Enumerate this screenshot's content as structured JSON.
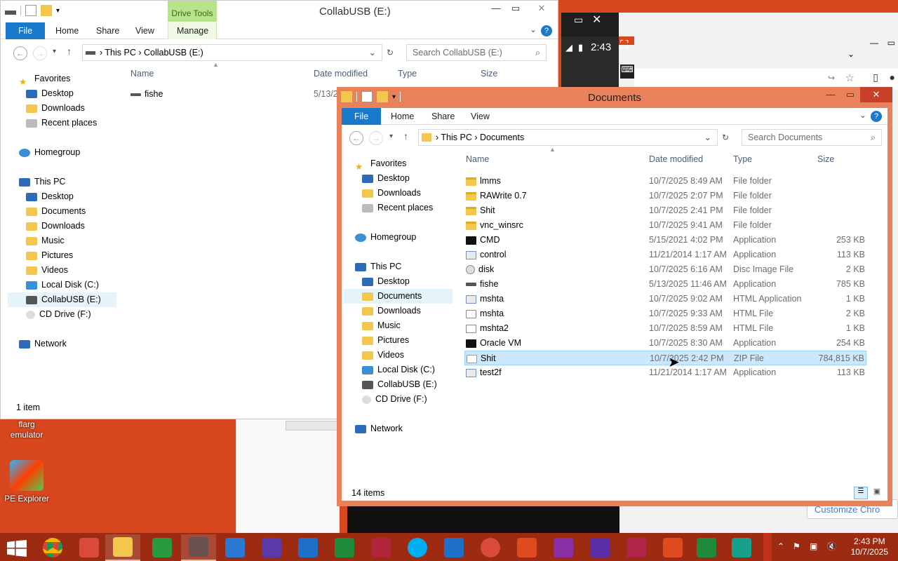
{
  "desktop": {
    "icons": [
      {
        "label": "flarg\nemulator"
      },
      {
        "label": "PE Explorer"
      }
    ]
  },
  "bg_window": {
    "time": "2:43",
    "customize_btn": "Customize Chro"
  },
  "win1": {
    "title": "CollabUSB (E:)",
    "drive_tools": "Drive Tools",
    "tabs": [
      "File",
      "Home",
      "Share",
      "View",
      "Manage"
    ],
    "address": [
      "This PC",
      "CollabUSB (E:)"
    ],
    "search_placeholder": "Search CollabUSB (E:)",
    "columns": [
      "Name",
      "Date modified",
      "Type",
      "Size"
    ],
    "rows": [
      {
        "name": "fishe",
        "date": "5/13/2"
      }
    ],
    "nav": {
      "favorites": "Favorites",
      "fav_items": [
        "Desktop",
        "Downloads",
        "Recent places"
      ],
      "homegroup": "Homegroup",
      "thispc": "This PC",
      "pc_items": [
        "Desktop",
        "Documents",
        "Downloads",
        "Music",
        "Pictures",
        "Videos",
        "Local Disk (C:)",
        "CollabUSB (E:)",
        "CD Drive (F:)"
      ],
      "network": "Network"
    },
    "status": "1 item"
  },
  "win2": {
    "title": "Documents",
    "tabs": [
      "File",
      "Home",
      "Share",
      "View"
    ],
    "address": [
      "This PC",
      "Documents"
    ],
    "search_placeholder": "Search Documents",
    "columns": [
      "Name",
      "Date modified",
      "Type",
      "Size"
    ],
    "rows": [
      {
        "name": "lmms",
        "date": "10/7/2025 8:49 AM",
        "type": "File folder",
        "size": "",
        "icon": "folder"
      },
      {
        "name": "RAWrite 0.7",
        "date": "10/7/2025 2:07 PM",
        "type": "File folder",
        "size": "",
        "icon": "folder"
      },
      {
        "name": "Shit",
        "date": "10/7/2025 2:41 PM",
        "type": "File folder",
        "size": "",
        "icon": "folder"
      },
      {
        "name": "vnc_winsrc",
        "date": "10/7/2025 9:41 AM",
        "type": "File folder",
        "size": "",
        "icon": "folder"
      },
      {
        "name": "CMD",
        "date": "5/15/2021 4:02 PM",
        "type": "Application",
        "size": "253 KB",
        "icon": "cmd"
      },
      {
        "name": "control",
        "date": "11/21/2014 1:17 AM",
        "type": "Application",
        "size": "113 KB",
        "icon": "app"
      },
      {
        "name": "disk",
        "date": "10/7/2025 6:16 AM",
        "type": "Disc Image File",
        "size": "2 KB",
        "icon": "disc"
      },
      {
        "name": "fishe",
        "date": "5/13/2025 11:46 AM",
        "type": "Application",
        "size": "785 KB",
        "icon": "drive"
      },
      {
        "name": "mshta",
        "date": "10/7/2025 9:02 AM",
        "type": "HTML Application",
        "size": "1 KB",
        "icon": "app"
      },
      {
        "name": "mshta",
        "date": "10/7/2025 9:33 AM",
        "type": "HTML File",
        "size": "2 KB",
        "icon": "html"
      },
      {
        "name": "mshta2",
        "date": "10/7/2025 8:59 AM",
        "type": "HTML File",
        "size": "1 KB",
        "icon": "html"
      },
      {
        "name": "Oracle VM",
        "date": "10/7/2025 8:30 AM",
        "type": "Application",
        "size": "254 KB",
        "icon": "cmd"
      },
      {
        "name": "Shit",
        "date": "10/7/2025 2:42 PM",
        "type": "ZIP File",
        "size": "784,815 KB",
        "icon": "zip"
      },
      {
        "name": "test2f",
        "date": "11/21/2014 1:17 AM",
        "type": "Application",
        "size": "113 KB",
        "icon": "app"
      }
    ],
    "nav": {
      "favorites": "Favorites",
      "fav_items": [
        "Desktop",
        "Downloads",
        "Recent places"
      ],
      "homegroup": "Homegroup",
      "thispc": "This PC",
      "pc_items": [
        "Desktop",
        "Documents",
        "Downloads",
        "Music",
        "Pictures",
        "Videos",
        "Local Disk (C:)",
        "CollabUSB (E:)",
        "CD Drive (F:)"
      ],
      "network": "Network"
    },
    "status": "14 items"
  },
  "taskbar": {
    "time": "2:43 PM",
    "date": "10/7/2025"
  }
}
